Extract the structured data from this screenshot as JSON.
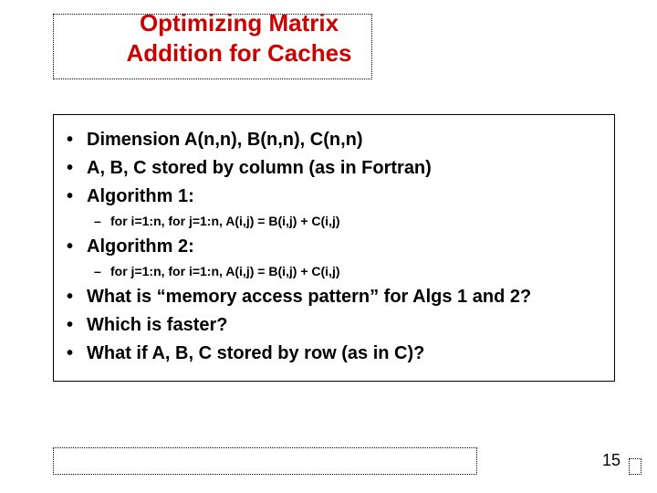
{
  "title": {
    "line1": "Optimizing Matrix",
    "line2": "Addition for Caches"
  },
  "bullets": {
    "b0": "Dimension A(n,n), B(n,n), C(n,n)",
    "b1": "A, B, C stored by column (as in Fortran)",
    "b2": "Algorithm 1:",
    "b2a": "for i=1:n, for j=1:n, A(i,j) = B(i,j) + C(i,j)",
    "b3": "Algorithm 2:",
    "b3a": "for j=1:n, for i=1:n, A(i,j) = B(i,j) + C(i,j)",
    "b4": "What is “memory access pattern” for Algs 1 and 2?",
    "b5": "Which is faster?",
    "b6": "What if A, B, C stored by row (as in C)?"
  },
  "page": "15"
}
